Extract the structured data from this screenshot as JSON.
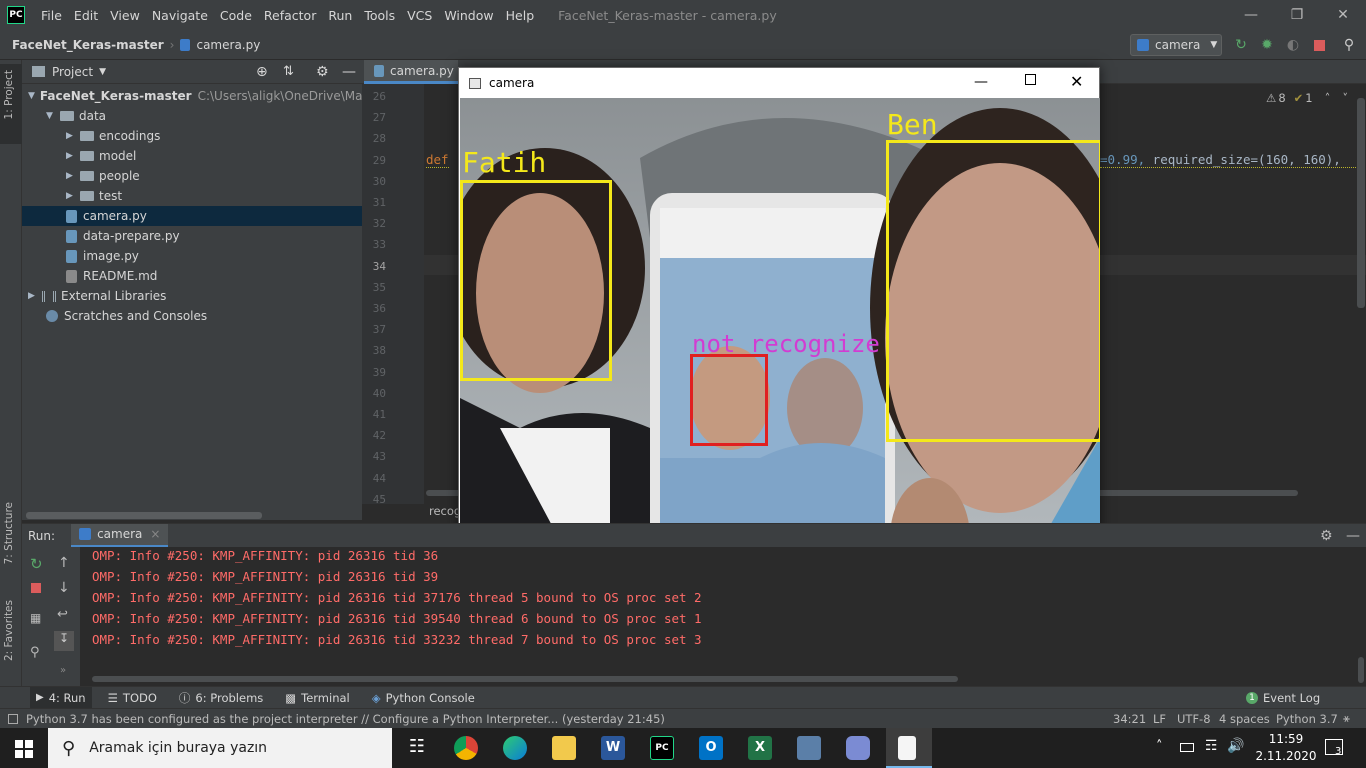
{
  "menubar": {
    "items": [
      "File",
      "Edit",
      "View",
      "Navigate",
      "Code",
      "Refactor",
      "Run",
      "Tools",
      "VCS",
      "Window",
      "Help"
    ],
    "title": "FaceNet_Keras-master - camera.py",
    "logo": "PC"
  },
  "navbar": {
    "project": "FaceNet_Keras-master",
    "file": "camera.py",
    "run_config": "camera"
  },
  "sidebar": {
    "project_tab": "1: Project",
    "structure_tab": "7: Structure",
    "favorites_tab": "2: Favorites"
  },
  "project_panel": {
    "title": "Project",
    "root_name": "FaceNet_Keras-master",
    "root_path": "C:\\Users\\aligk\\OneDrive\\Masaü",
    "items": [
      {
        "label": "data"
      },
      {
        "label": "encodings"
      },
      {
        "label": "model"
      },
      {
        "label": "people"
      },
      {
        "label": "test"
      },
      {
        "label": "camera.py"
      },
      {
        "label": "data-prepare.py"
      },
      {
        "label": "image.py"
      },
      {
        "label": "README.md"
      },
      {
        "label": "External Libraries"
      },
      {
        "label": "Scratches and Consoles"
      }
    ]
  },
  "editor": {
    "tab": "camera.py",
    "line_numbers": [
      "26",
      "27",
      "28",
      "29",
      "30",
      "31",
      "32",
      "33",
      "34",
      "35",
      "36",
      "37",
      "38",
      "39",
      "40",
      "41",
      "42",
      "43",
      "44",
      "45"
    ],
    "keyword_def": "def",
    "code_fragment_1": "=0.99,",
    "code_fragment_2": " required_size=(160, 160),",
    "warnings": "8",
    "weak_warnings": "1",
    "footer_text": "recog"
  },
  "camera_window": {
    "title": "camera",
    "faces": [
      {
        "name": "Fatih",
        "color": "#f4e81a"
      },
      {
        "name": "Ben",
        "color": "#f4e81a"
      },
      {
        "name": "not recognize",
        "color": "#e02020",
        "label_color": "#d23cd2"
      }
    ]
  },
  "run_panel": {
    "label": "Run:",
    "tab": "camera",
    "lines": [
      "OMP: Info #250: KMP_AFFINITY: pid 26316 tid 36",
      "OMP: Info #250: KMP_AFFINITY: pid 26316 tid 39",
      "OMP: Info #250: KMP_AFFINITY: pid 26316 tid 37176 thread 5 bound to OS proc set 2",
      "OMP: Info #250: KMP_AFFINITY: pid 26316 tid 39540 thread 6 bound to OS proc set 1",
      "OMP: Info #250: KMP_AFFINITY: pid 26316 tid 33232 thread 7 bound to OS proc set 3"
    ]
  },
  "tool_tabs": {
    "run": "4: Run",
    "todo": "TODO",
    "problems": "6: Problems",
    "terminal": "Terminal",
    "python_console": "Python Console",
    "event_log": "Event Log"
  },
  "status_bar": {
    "message": "Python 3.7 has been configured as the project interpreter // Configure a Python Interpreter... (yesterday 21:45)",
    "position": "34:21",
    "line_sep": "LF",
    "encoding": "UTF-8",
    "indent": "4 spaces",
    "interpreter": "Python 3.7"
  },
  "taskbar": {
    "search_placeholder": "Aramak için buraya yazın",
    "time": "11:59",
    "date": "2.11.2020",
    "notifications": "3"
  },
  "colors": {
    "ide_bg": "#2b2b2b",
    "panel_bg": "#3c3f41",
    "console_error": "#ff6b68",
    "selection": "#0d293e"
  }
}
